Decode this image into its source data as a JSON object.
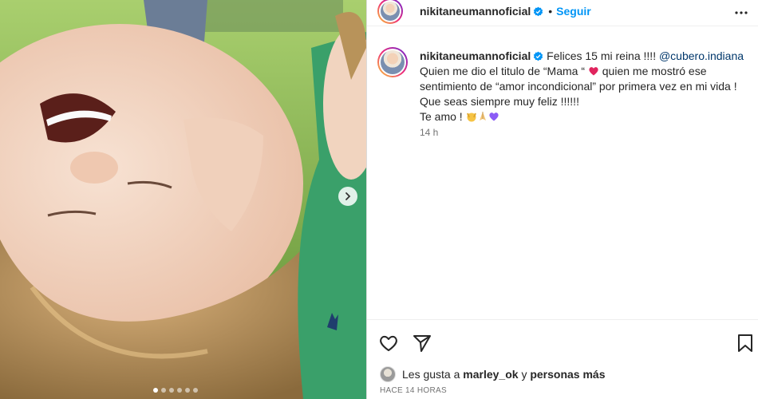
{
  "header": {
    "username": "nikitaneumannoficial",
    "separator": "•",
    "follow_label": "Seguir"
  },
  "caption": {
    "username": "nikitaneumannoficial",
    "line1_text": "Felices 15 mi reina !!!!",
    "mention": "@cubero.indiana",
    "line2_a": "Quien me dio el titulo de “Mama “",
    "line2_b": "quien me mostró ese",
    "line3": "sentimiento de “amor incondicional” por primera vez en mi vida !",
    "line4": "Que seas siempre muy feliz !!!!!!",
    "line5": "Te amo !",
    "relative_time": "14 h"
  },
  "likes": {
    "prefix": "Les gusta a",
    "user": "marley_ok",
    "connector": "y",
    "rest": "personas más"
  },
  "post_date": "HACE 14 HORAS",
  "carousel": {
    "slide_count": 6,
    "active_index": 0
  },
  "icons": {
    "more": "more-horizontal-icon",
    "like": "heart-icon",
    "share": "send-icon",
    "save": "bookmark-icon",
    "next": "chevron-right-icon",
    "verified": "verified-badge-icon"
  },
  "colors": {
    "accent": "#0095f6",
    "verified": "#0095f6",
    "heart_emoji": "#e0245e",
    "purple_heart": "#8b5cf6"
  }
}
